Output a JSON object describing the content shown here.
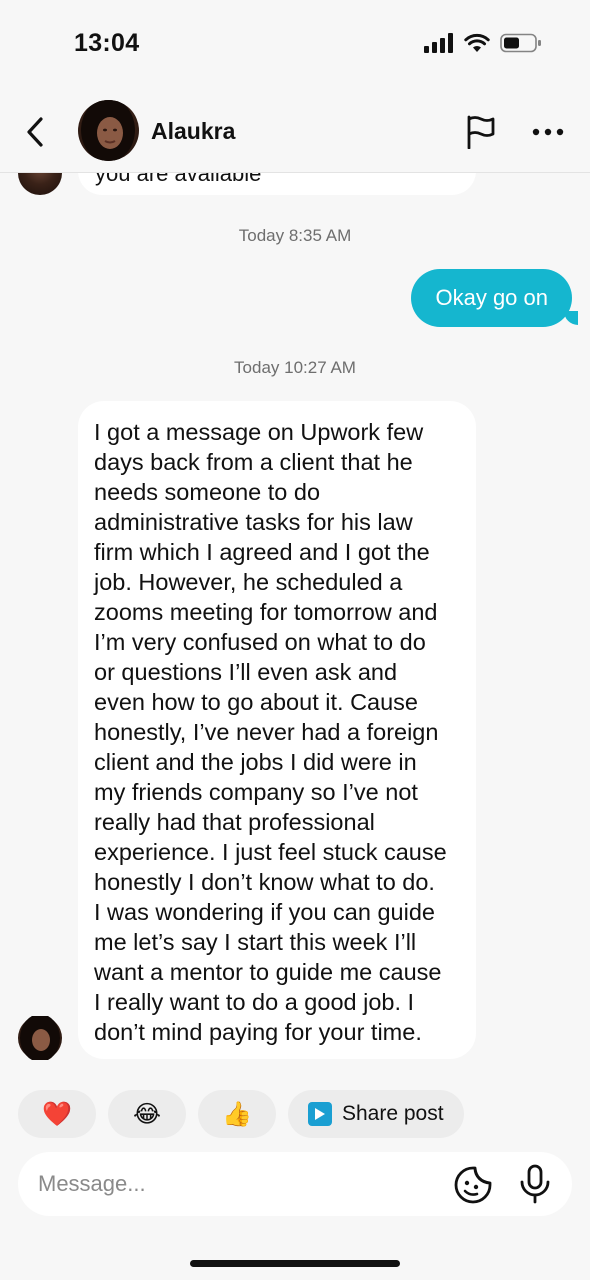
{
  "status_bar": {
    "time": "13:04"
  },
  "header": {
    "contact_name": "Alaukra"
  },
  "chat": {
    "cut_message_text": "you are available",
    "timestamp_1": "Today 8:35 AM",
    "sent_message": "Okay go on",
    "timestamp_2": "Today 10:27 AM",
    "received_message_lines": [
      "I got a message on Upwork few",
      "days back from a client that he",
      "needs someone to do",
      "administrative tasks for his law",
      "firm which I agreed and I got the",
      "job. However, he scheduled a",
      "zooms meeting for tomorrow and",
      "I’m very confused on what to do",
      "or questions I’ll even ask and",
      "even how to go about it. Cause",
      "honestly, I’ve never had a foreign",
      "client and the jobs I did were in",
      "my friends company so I’ve not",
      "really had that professional",
      "experience. I just feel stuck cause",
      "honestly I don’t know what to do.",
      "I was wondering if you can guide",
      "me let’s say I start this week I’ll",
      "want a mentor to guide me cause",
      "I really want to do a good job. I",
      "don’t mind paying for your time."
    ]
  },
  "quick_replies": {
    "heart": "❤️",
    "laugh": "😂",
    "thumbs_up": "👍",
    "share_post_label": "Share post"
  },
  "composer": {
    "placeholder": "Message..."
  },
  "colors": {
    "sent_bubble": "#15b6cf",
    "background": "#f7f7f7",
    "chip": "#ececec",
    "share_icon": "#1a9fd2"
  },
  "icons": [
    "back-icon",
    "flag-icon",
    "more-icon",
    "play-icon",
    "sticker-icon",
    "microphone-icon",
    "signal-icon",
    "wifi-icon",
    "battery-icon"
  ]
}
